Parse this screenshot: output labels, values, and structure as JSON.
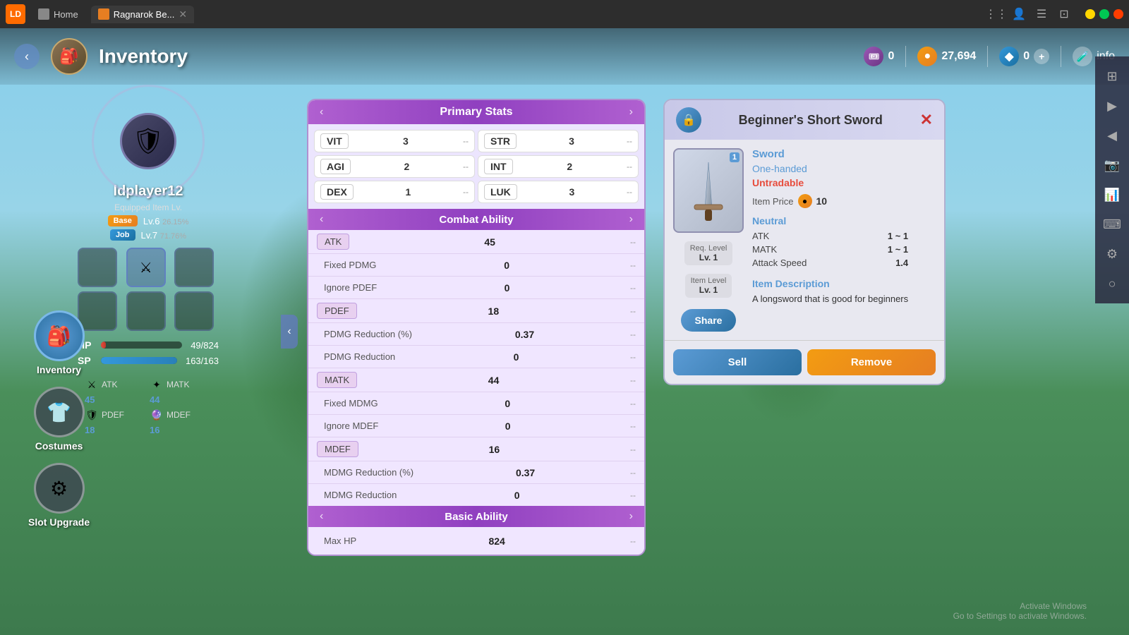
{
  "titlebar": {
    "app_name": "LDPlayer",
    "home_tab": "Home",
    "game_tab": "Ragnarok Be...",
    "window_controls": [
      "minimize",
      "maximize",
      "close"
    ]
  },
  "header": {
    "back_label": "‹",
    "title": "Inventory",
    "currency_ticket": "0",
    "currency_coin": "27,694",
    "currency_gem": "0",
    "info_label": "info"
  },
  "character": {
    "name": "ldplayer12",
    "equipped_label": "Equipped Item Lv.",
    "base_level_badge": "Base",
    "base_level": "Lv.6",
    "base_exp": "26.15%",
    "job_level_badge": "Job",
    "job_level": "Lv.7",
    "job_exp": "71.76%",
    "hp_current": "49",
    "hp_max": "824",
    "sp_current": "163",
    "sp_max": "163",
    "atk_label": "ATK",
    "atk_val": "45",
    "matk_label": "MATK",
    "matk_val": "44",
    "pdef_label": "PDEF",
    "pdef_val": "18",
    "mdef_label": "MDEF",
    "mdef_val": "16"
  },
  "nav": {
    "inventory_label": "Inventory",
    "costumes_label": "Costumes",
    "slot_upgrade_label": "Slot Upgrade"
  },
  "primary_stats": {
    "header": "Primary Stats",
    "vit_label": "VIT",
    "vit_val": "3",
    "str_label": "STR",
    "str_val": "3",
    "agi_label": "AGI",
    "agi_val": "2",
    "int_label": "INT",
    "int_val": "2",
    "dex_label": "DEX",
    "dex_val": "1",
    "luk_label": "LUK",
    "luk_val": "3"
  },
  "combat_ability": {
    "header": "Combat Ability",
    "atk_label": "ATK",
    "atk_val": "45",
    "fixed_pdmg_label": "Fixed PDMG",
    "fixed_pdmg_val": "0",
    "ignore_pdef_label": "Ignore PDEF",
    "ignore_pdef_val": "0",
    "pdef_label": "PDEF",
    "pdef_val": "18",
    "pdmg_reduction_pct_label": "PDMG Reduction (%)",
    "pdmg_reduction_pct_val": "0.37",
    "pdmg_reduction_label": "PDMG Reduction",
    "pdmg_reduction_val": "0",
    "matk_label": "MATK",
    "matk_val": "44",
    "fixed_mdmg_label": "Fixed MDMG",
    "fixed_mdmg_val": "0",
    "ignore_mdef_label": "Ignore MDEF",
    "ignore_mdef_val": "0",
    "mdef_label": "MDEF",
    "mdef_val": "16",
    "mdmg_reduction_pct_label": "MDMG Reduction (%)",
    "mdmg_reduction_pct_val": "0.37",
    "mdmg_reduction_label": "MDMG Reduction",
    "mdmg_reduction_val": "0"
  },
  "basic_ability": {
    "header": "Basic Ability",
    "max_hp_label": "Max HP",
    "max_hp_val": "824"
  },
  "item_detail": {
    "title": "Beginner's Short Sword",
    "type_sword": "Sword",
    "type_hand": "One-handed",
    "tradability": "Untradable",
    "price_label": "Item Price",
    "price_val": "10",
    "req_level_label": "Req. Level",
    "req_level_val": "Lv. 1",
    "item_level_label": "Item Level",
    "item_level_val": "Lv. 1",
    "share_label": "Share",
    "neutral_header": "Neutral",
    "atk_label": "ATK",
    "atk_range": "1 ~ 1",
    "matk_label": "MATK",
    "matk_range": "1 ~ 1",
    "attack_speed_label": "Attack Speed",
    "attack_speed_val": "1.4",
    "desc_header": "Item Description",
    "description": "A longsword that is good for beginners",
    "sell_label": "Sell",
    "remove_label": "Remove"
  },
  "activate_windows": {
    "line1": "Activate Windows",
    "line2": "Go to Settings to activate Windows."
  }
}
